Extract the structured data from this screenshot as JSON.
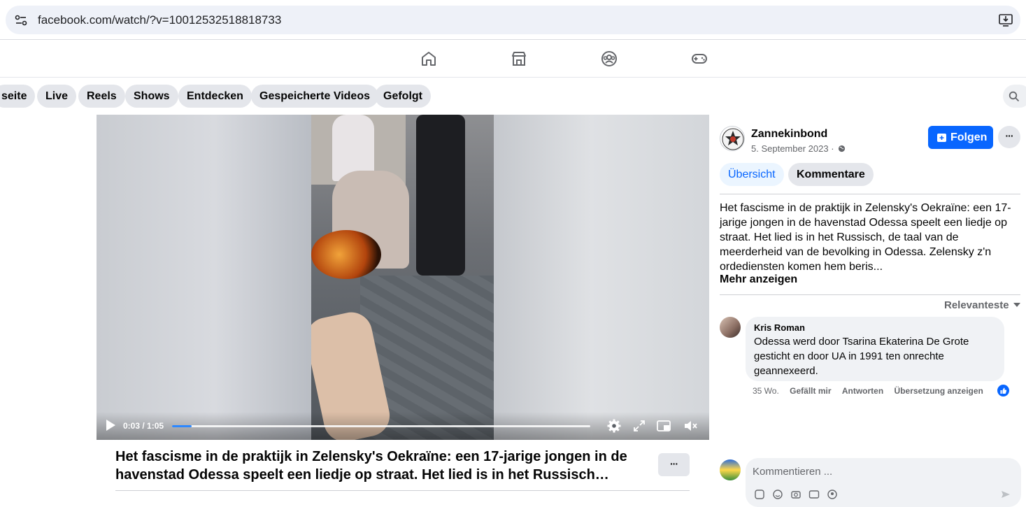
{
  "browser": {
    "url": "facebook.com/watch/?v=10012532518818733"
  },
  "nav": {
    "icons": [
      "home-icon",
      "marketplace-icon",
      "groups-icon",
      "gaming-icon"
    ]
  },
  "watch_tabs": {
    "items": [
      "seite",
      "Live",
      "Reels",
      "Shows",
      "Entdecken",
      "Gespeicherte Videos",
      "Gefolgt"
    ],
    "search_icon": "search-icon"
  },
  "video": {
    "timecode": "0:03 / 1:05",
    "progress": 0.046,
    "accent": "#2d88ff",
    "title": "Het fascisme in de praktijk in Zelensky's Oekraïne: een 17-jarige jongen in de havenstad Odessa speelt een liedje op straat. Het lied is in het Russisch…",
    "more_label": "···"
  },
  "post": {
    "page_name": "Zannekinbond",
    "date": "5. September 2023 · ",
    "follow_label": "Folgen",
    "more_label": "···",
    "tabs": {
      "overview": "Übersicht",
      "comments": "Kommentare"
    },
    "description": "Het fascisme in de praktijk in Zelensky's Oekraïne: een 17-jarige jongen in de havenstad Odessa speelt een liedje op straat. Het lied is in het Russisch, de taal van de meerderheid van de bevolking in Odessa. Zelensky z'n ordediensten komen hem beris...",
    "show_more": "Mehr anzeigen",
    "sort_label": "Relevanteste"
  },
  "comment": {
    "author": "Kris Roman",
    "text": "Odessa werd door Tsarina Ekaterina De Grote gesticht en door UA in 1991 ten onrechte geannexeerd.",
    "age": "35 Wo.",
    "like": "Gefällt mir",
    "reply": "Antworten",
    "translate": "Übersetzung anzeigen"
  },
  "composer": {
    "placeholder": "Kommentieren ..."
  },
  "colors": {
    "brand": "#0866ff",
    "chip_bg": "#e4e6eb",
    "secondary_text": "#65676b"
  }
}
